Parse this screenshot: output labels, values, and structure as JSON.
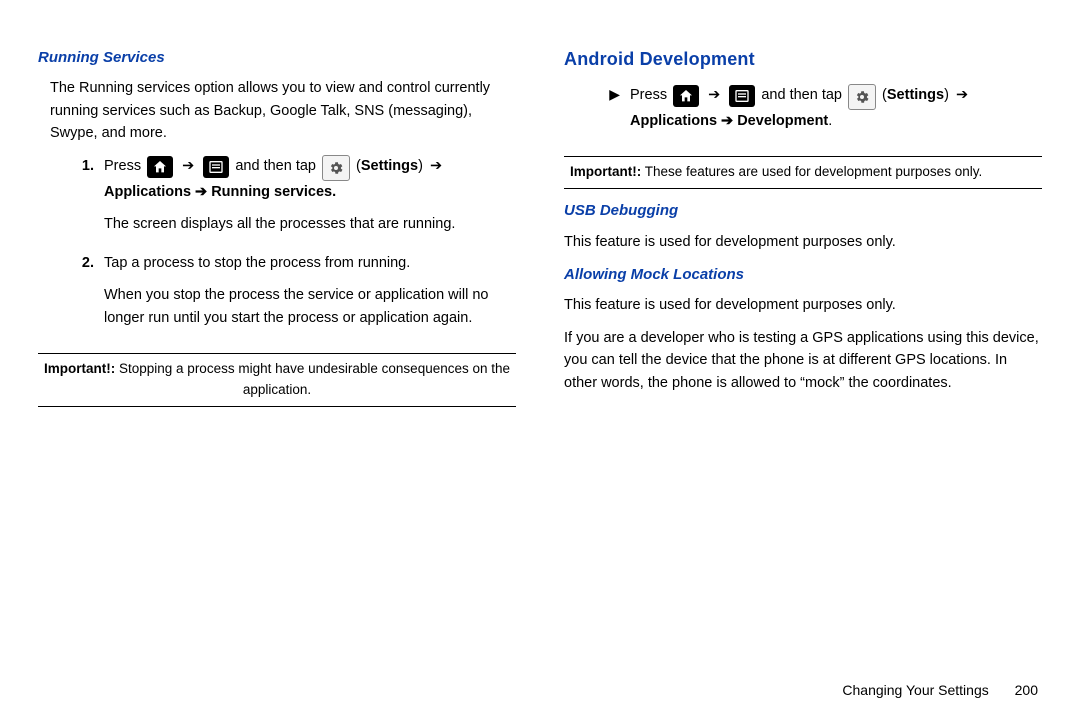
{
  "left": {
    "h_running": "Running Services",
    "intro": "The Running services option allows you to view and control currently running services such as Backup, Google Talk, SNS (messaging), Swype, and more.",
    "step1_num": "1.",
    "press": "Press ",
    "and_tap": " and then tap ",
    "settings_label": "Settings",
    "running_path": "Applications ➔ Running services.",
    "step1_body2": "The screen displays all the processes that are running.",
    "step2_num": "2.",
    "step2_body1": "Tap a process to stop the process from running.",
    "step2_body2": "When you stop the process the service or application will no longer run until you start the process or application again.",
    "note_label": "Important!:",
    "note_text": " Stopping a process might have undesirable consequences on the application."
  },
  "right": {
    "h_android": "Android Development",
    "press": "Press ",
    "and_tap": " and then tap ",
    "settings_label": "Settings",
    "dev_path": "Applications ➔ Development",
    "note_label": "Important!:",
    "note_text": " These features are used for development purposes only.",
    "h_usb": "USB Debugging",
    "usb_text": "This feature is used for development purposes only.",
    "h_mock": "Allowing Mock Locations",
    "mock_p1": "This feature is used for development purposes only.",
    "mock_p2": "If you are a developer who is testing a GPS applications using this device, you can tell the device that the phone is at different GPS locations. In other words, the phone is allowed to “mock” the coordinates."
  },
  "arrow": "➔",
  "bullet": "▶",
  "footer": {
    "section": "Changing Your Settings",
    "page": "200"
  }
}
